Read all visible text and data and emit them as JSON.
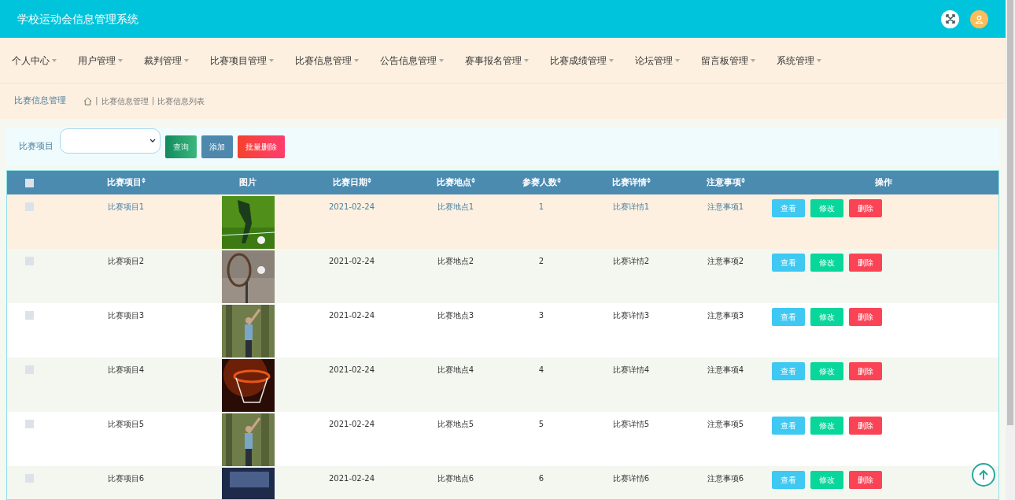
{
  "header": {
    "title": "学校运动会信息管理系统"
  },
  "nav": [
    {
      "label": "个人中心"
    },
    {
      "label": "用户管理"
    },
    {
      "label": "裁判管理"
    },
    {
      "label": "比赛项目管理"
    },
    {
      "label": "比赛信息管理"
    },
    {
      "label": "公告信息管理"
    },
    {
      "label": "赛事报名管理"
    },
    {
      "label": "比赛成绩管理"
    },
    {
      "label": "论坛管理"
    },
    {
      "label": "留言板管理"
    },
    {
      "label": "系统管理"
    }
  ],
  "breadcrumb": {
    "title": "比赛信息管理",
    "path": [
      {
        "separator": "|",
        "label": "比赛信息管理"
      },
      {
        "separator": "|",
        "label": "比赛信息列表"
      }
    ]
  },
  "filter": {
    "label": "比赛项目",
    "buttons": [
      {
        "label": "查询",
        "kind": "search"
      },
      {
        "label": "添加",
        "kind": "add"
      },
      {
        "label": "批量删除",
        "kind": "delete"
      }
    ]
  },
  "table": {
    "select_all_checked": false,
    "columns": [
      "比赛项目",
      "图片",
      "比赛日期",
      "比赛地点",
      "参赛人数",
      "比赛详情",
      "注意事项",
      "操作"
    ],
    "rows": [
      {
        "cells": [
          {
            "kind": "text",
            "text": "比赛项目1"
          },
          {
            "kind": "picture"
          },
          {
            "kind": "text",
            "text": "2021-02-24"
          },
          {
            "kind": "text",
            "text": "比赛地点1"
          },
          {
            "kind": "text",
            "text": "1"
          },
          {
            "kind": "text",
            "text": "比赛详情1"
          },
          {
            "kind": "text",
            "text": "注意事项1"
          }
        ],
        "actions": [
          {
            "label": "查看",
            "kind": "view"
          },
          {
            "label": "修改",
            "kind": "edit"
          },
          {
            "label": "删除",
            "kind": "delete"
          }
        ],
        "highlighted": true,
        "checked": false
      },
      {
        "cells": [
          {
            "kind": "text",
            "text": "比赛项目2"
          },
          {
            "kind": "picture"
          },
          {
            "kind": "text",
            "text": "2021-02-24"
          },
          {
            "kind": "text",
            "text": "比赛地点2"
          },
          {
            "kind": "text",
            "text": "2"
          },
          {
            "kind": "text",
            "text": "比赛详情2"
          },
          {
            "kind": "text",
            "text": "注意事项2"
          }
        ],
        "actions": [
          {
            "label": "查看",
            "kind": "view"
          },
          {
            "label": "修改",
            "kind": "edit"
          },
          {
            "label": "删除",
            "kind": "delete"
          }
        ],
        "highlighted": false,
        "checked": false
      },
      {
        "cells": [
          {
            "kind": "text",
            "text": "比赛项目3"
          },
          {
            "kind": "picture"
          },
          {
            "kind": "text",
            "text": "2021-02-24"
          },
          {
            "kind": "text",
            "text": "比赛地点3"
          },
          {
            "kind": "text",
            "text": "3"
          },
          {
            "kind": "text",
            "text": "比赛详情3"
          },
          {
            "kind": "text",
            "text": "注意事项3"
          }
        ],
        "actions": [
          {
            "label": "查看",
            "kind": "view"
          },
          {
            "label": "修改",
            "kind": "edit"
          },
          {
            "label": "删除",
            "kind": "delete"
          }
        ],
        "highlighted": false,
        "checked": false
      },
      {
        "cells": [
          {
            "kind": "text",
            "text": "比赛项目4"
          },
          {
            "kind": "picture"
          },
          {
            "kind": "text",
            "text": "2021-02-24"
          },
          {
            "kind": "text",
            "text": "比赛地点4"
          },
          {
            "kind": "text",
            "text": "4"
          },
          {
            "kind": "text",
            "text": "比赛详情4"
          },
          {
            "kind": "text",
            "text": "注意事项4"
          }
        ],
        "actions": [
          {
            "label": "查看",
            "kind": "view"
          },
          {
            "label": "修改",
            "kind": "edit"
          },
          {
            "label": "删除",
            "kind": "delete"
          }
        ],
        "highlighted": false,
        "checked": false
      },
      {
        "cells": [
          {
            "kind": "text",
            "text": "比赛项目5"
          },
          {
            "kind": "picture"
          },
          {
            "kind": "text",
            "text": "2021-02-24"
          },
          {
            "kind": "text",
            "text": "比赛地点5"
          },
          {
            "kind": "text",
            "text": "5"
          },
          {
            "kind": "text",
            "text": "比赛详情5"
          },
          {
            "kind": "text",
            "text": "注意事项5"
          }
        ],
        "actions": [
          {
            "label": "查看",
            "kind": "view"
          },
          {
            "label": "修改",
            "kind": "edit"
          },
          {
            "label": "删除",
            "kind": "delete"
          }
        ],
        "highlighted": false,
        "checked": false
      },
      {
        "cells": [
          {
            "kind": "text",
            "text": "比赛项目6"
          },
          {
            "kind": "picture"
          },
          {
            "kind": "text",
            "text": "2021-02-24"
          },
          {
            "kind": "text",
            "text": "比赛地点6"
          },
          {
            "kind": "text",
            "text": "6"
          },
          {
            "kind": "text",
            "text": "比赛详情6"
          },
          {
            "kind": "text",
            "text": "注意事项6"
          }
        ],
        "actions": [
          {
            "label": "查看",
            "kind": "view"
          },
          {
            "label": "修改",
            "kind": "edit"
          },
          {
            "label": "删除",
            "kind": "delete"
          }
        ],
        "highlighted": false,
        "checked": false
      }
    ]
  }
}
